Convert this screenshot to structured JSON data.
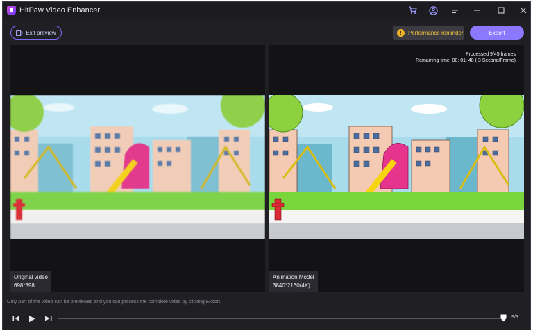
{
  "app": {
    "title": "HitPaw Video Enhancer",
    "icons": [
      "cart-icon",
      "account-icon",
      "menu-icon",
      "minimize-icon",
      "maximize-icon",
      "close-icon"
    ]
  },
  "toolbar": {
    "exit_label": "Exit preview",
    "performance_label": "Performance reminder",
    "export_label": "Export"
  },
  "colors": {
    "accent": "#8b78ff",
    "warning": "#f0b429",
    "background": "#1f1f24"
  },
  "left_panel": {
    "label": "Original video",
    "resolution": "698*398"
  },
  "right_panel": {
    "label": "Animation Model",
    "resolution": "3840*2160(4K)",
    "processed": "Processed 9/45 frames",
    "remaining": "Remaining time: 00: 01: 48 ( 3 Second/Frame)"
  },
  "footer": {
    "hint": "Only part of the video can be previewed and you can process the complete video by clicking Export.",
    "frame_count": "9/9",
    "progress": 1.0
  }
}
